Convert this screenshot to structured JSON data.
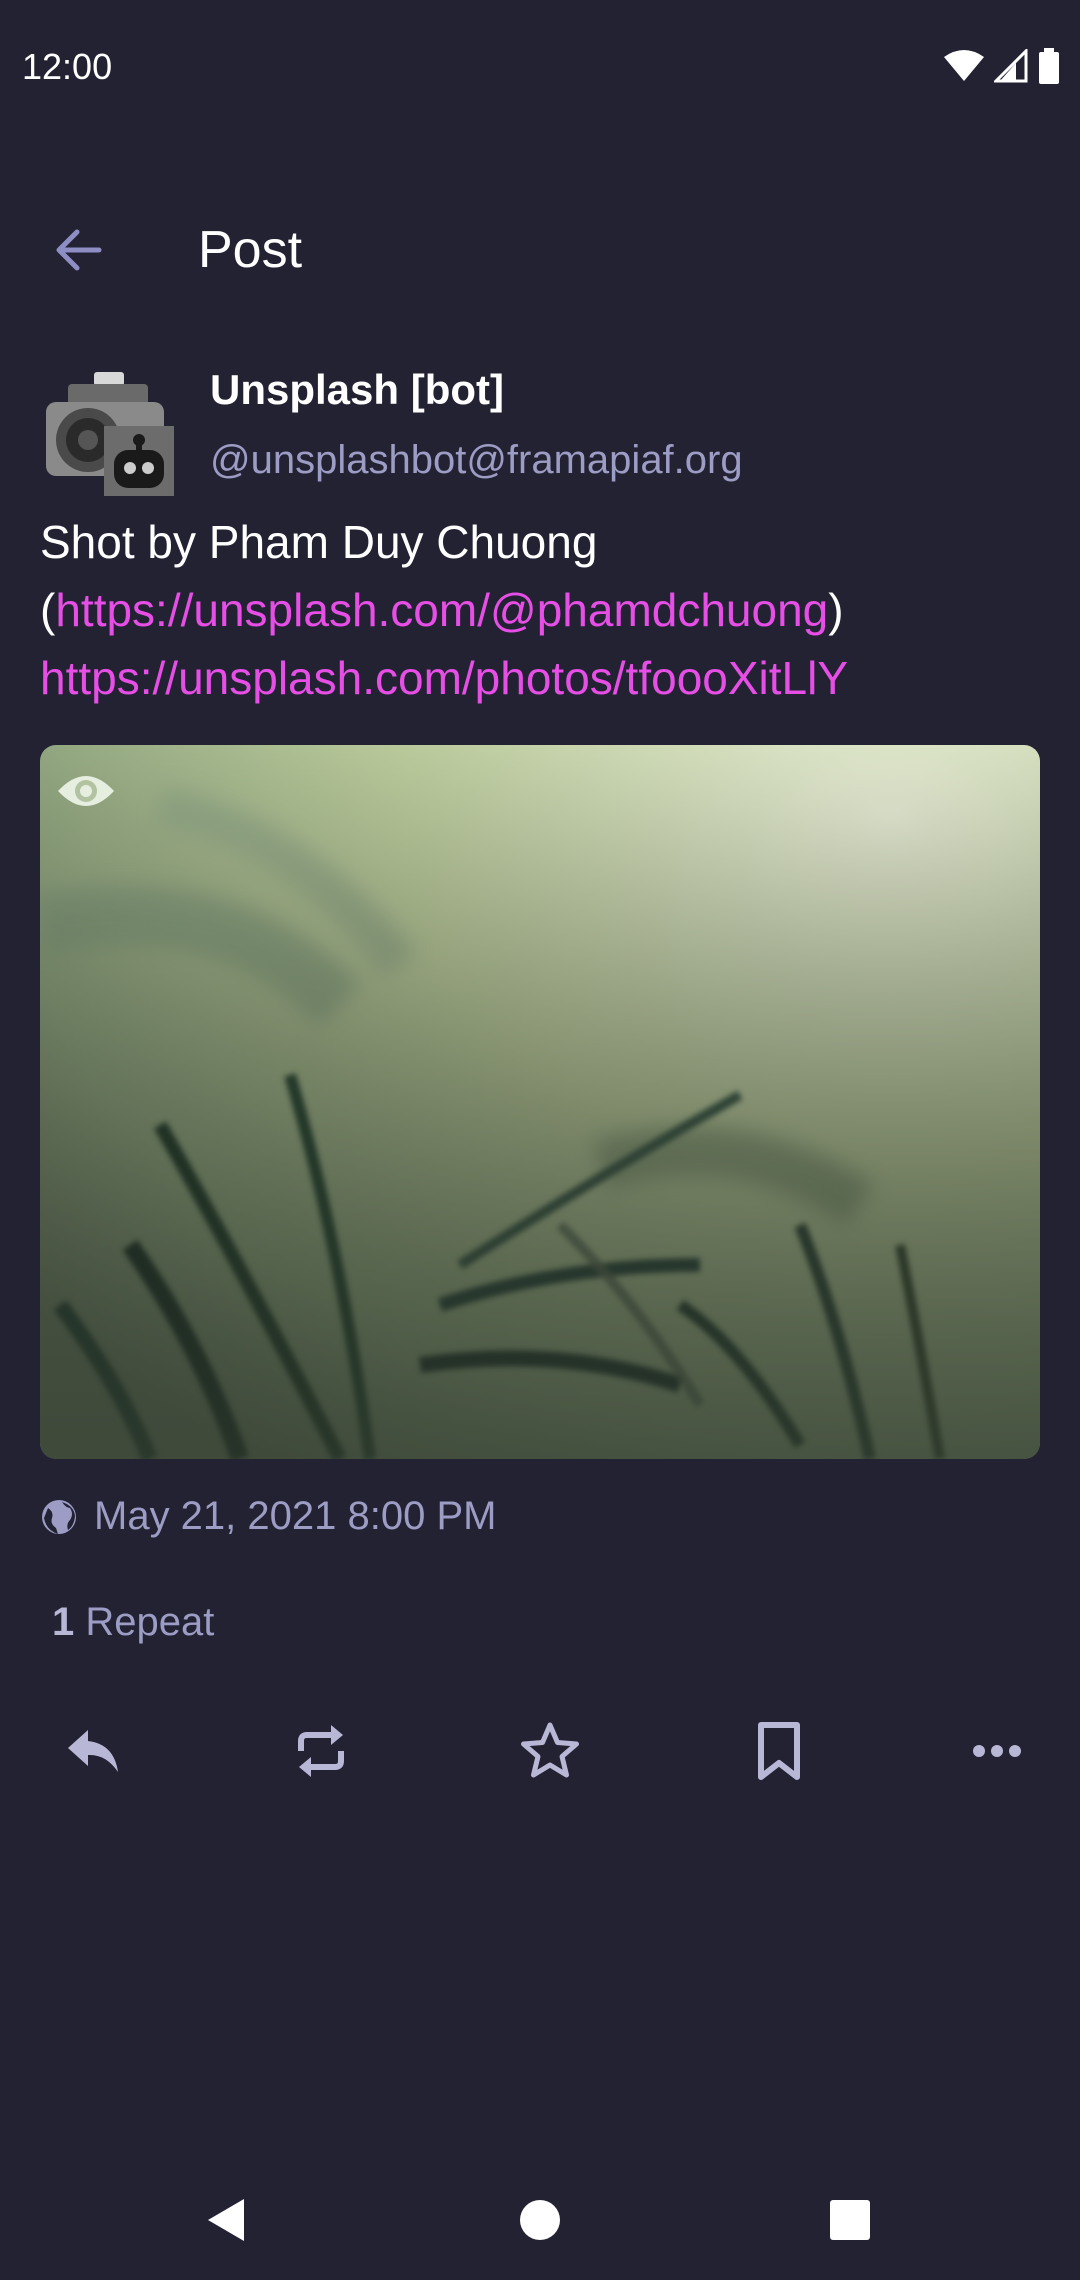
{
  "status_bar": {
    "time": "12:00"
  },
  "app_bar": {
    "title": "Post"
  },
  "post": {
    "display_name": "Unsplash [bot]",
    "username": "@unsplashbot@framapiaf.org",
    "content_prefix": "Shot by Pham Duy Chuong (",
    "content_link_1": "https://unsplash.com/@phamdchuong",
    "content_suffix": ")",
    "content_link_2": "https://unsplash.com/photos/tfoooXitLlY",
    "date": "May 21, 2021 8:00 PM",
    "repeat_count": "1",
    "repeat_label": "Repeat"
  },
  "colors": {
    "background": "#222233",
    "link": "#e64ee6",
    "secondary_text": "#9c9cc4",
    "icon": "#b8b8d6"
  },
  "icons": {
    "back": "arrow-left-icon",
    "visibility": "globe-icon",
    "sensitive": "eye-icon",
    "reply": "reply-icon",
    "reblog": "repeat-icon",
    "favourite": "star-icon",
    "bookmark": "bookmark-icon",
    "more": "more-horizontal-icon"
  }
}
